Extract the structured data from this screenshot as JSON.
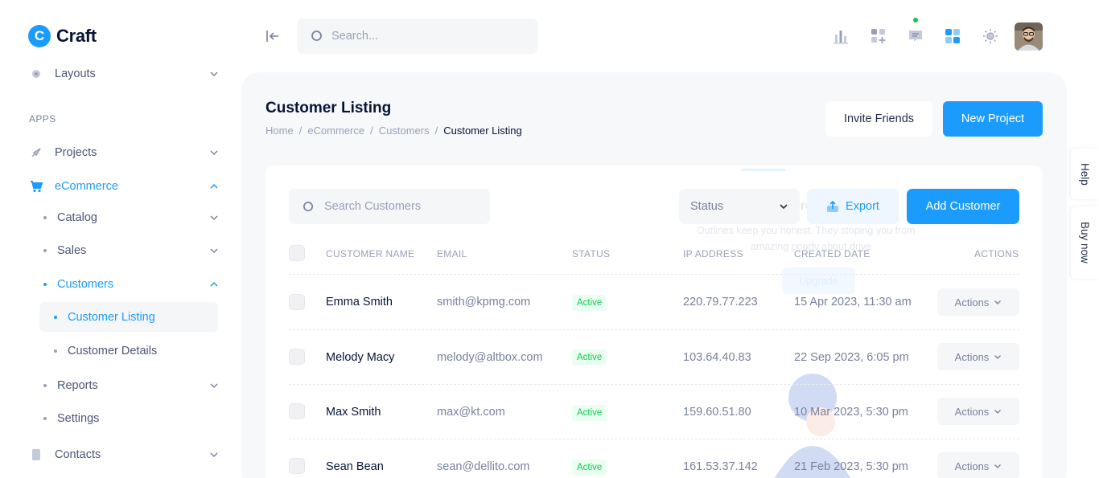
{
  "brand": {
    "name": "Craft",
    "mark": "C"
  },
  "sidebar": {
    "layouts": "Layouts",
    "section_apps": "APPS",
    "projects": "Projects",
    "ecommerce": "eCommerce",
    "catalog": "Catalog",
    "sales": "Sales",
    "customers": "Customers",
    "customer_listing": "Customer Listing",
    "customer_details": "Customer Details",
    "reports": "Reports",
    "settings": "Settings",
    "contacts": "Contacts"
  },
  "header": {
    "search_placeholder": "Search...",
    "icons": [
      "chart-bar-icon",
      "apps-add-icon",
      "chat-icon",
      "grid-icon",
      "sun-icon"
    ]
  },
  "page": {
    "title": "Customer Listing",
    "breadcrumb": [
      "Home",
      "eCommerce",
      "Customers",
      "Customer Listing"
    ],
    "invite_label": "Invite Friends",
    "new_project_label": "New Project"
  },
  "toolbar": {
    "search_placeholder": "Search Customers",
    "status_label": "Status",
    "export_label": "Export",
    "add_label": "Add Customer"
  },
  "ghost": {
    "title": "Get Pro Access",
    "line1": "Outlines keep you honest. They stoping you from",
    "line2": "amazing poorly about drive",
    "button": "Upgrade"
  },
  "table": {
    "headers": [
      "CUSTOMER NAME",
      "EMAIL",
      "STATUS",
      "IP ADDRESS",
      "CREATED DATE",
      "ACTIONS"
    ],
    "rows": [
      {
        "name": "Emma Smith",
        "email": "smith@kpmg.com",
        "status": "Active",
        "ip": "220.79.77.223",
        "date": "15 Apr 2023, 11:30 am",
        "action": "Actions"
      },
      {
        "name": "Melody Macy",
        "email": "melody@altbox.com",
        "status": "Active",
        "ip": "103.64.40.83",
        "date": "22 Sep 2023, 6:05 pm",
        "action": "Actions"
      },
      {
        "name": "Max Smith",
        "email": "max@kt.com",
        "status": "Active",
        "ip": "159.60.51.80",
        "date": "10 Mar 2023, 5:30 pm",
        "action": "Actions"
      },
      {
        "name": "Sean Bean",
        "email": "sean@dellito.com",
        "status": "Active",
        "ip": "161.53.37.142",
        "date": "21 Feb 2023, 5:30 pm",
        "action": "Actions"
      }
    ]
  },
  "side_tabs": {
    "help": "Help",
    "buy": "Buy now"
  },
  "colors": {
    "accent": "#1b9cfc",
    "success": "#17c653",
    "text": "#071437",
    "muted": "#78829d"
  }
}
